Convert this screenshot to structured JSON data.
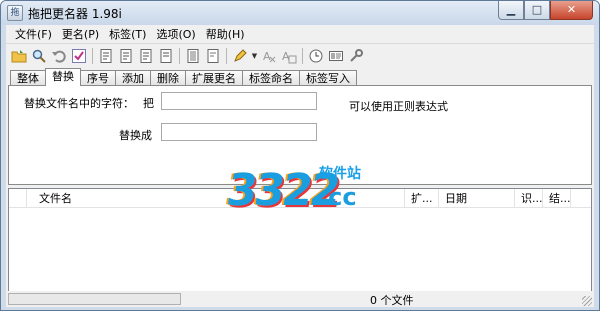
{
  "window": {
    "title": "拖把更名器 1.98i",
    "app_icon_label": "拖"
  },
  "menu": [
    "文件(F)",
    "更名(P)",
    "标签(T)",
    "选项(O)",
    "帮助(H)"
  ],
  "toolbar": {
    "icons": [
      "open-folder-icon",
      "search-icon",
      "undo-icon",
      "check-icon",
      "edit-file-1-icon",
      "edit-file-2-icon",
      "edit-file-3-icon",
      "edit-file-4-icon",
      "list-icon",
      "document-icon",
      "highlighter-icon",
      "tag-remove-icon",
      "tag-edit-icon",
      "clock-icon",
      "image-icon",
      "tools-icon"
    ]
  },
  "tabs": [
    "整体",
    "替换",
    "序号",
    "添加",
    "删除",
    "扩展更名",
    "标签命名",
    "标签写入"
  ],
  "active_tab": "替换",
  "replace": {
    "find_label": "替换文件名中的字符：",
    "find_prefix": "把",
    "find_value": "",
    "replace_label": "替换成",
    "replace_value": "",
    "regex_hint": "可以使用正则表达式"
  },
  "columns": [
    "文件名",
    "扩...",
    "日期",
    "识...",
    "结..."
  ],
  "rows": [],
  "status": {
    "text": "0 个文件",
    "progress": 0
  },
  "watermark": {
    "number": "3322",
    "cn": "软件站",
    "domain": ".cc"
  },
  "colors": {
    "accent": "#1a9ee0",
    "progress": "#06b025"
  }
}
